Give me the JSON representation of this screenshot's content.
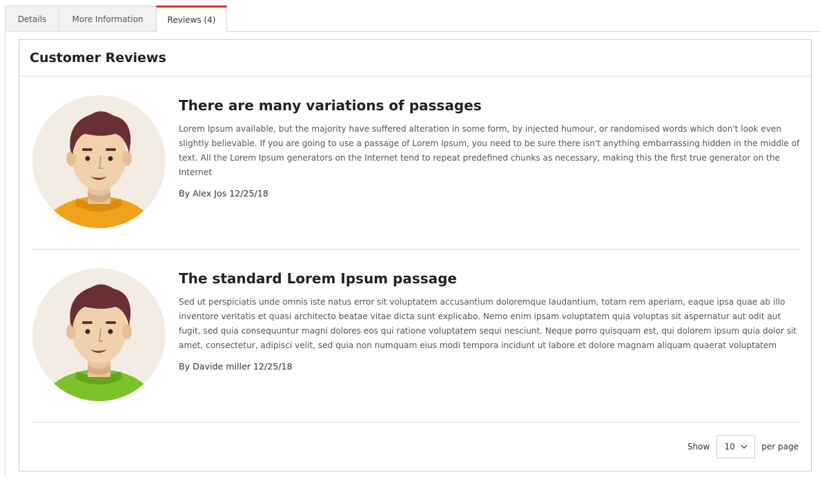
{
  "tabs": [
    {
      "label": "Details",
      "active": false
    },
    {
      "label": "More Information",
      "active": false
    },
    {
      "label": "Reviews (4)",
      "active": true
    }
  ],
  "accent_color": "#e02b27",
  "panel": {
    "title": "Customer Reviews"
  },
  "reviews": [
    {
      "title": "There are many variations of passages",
      "text": "Lorem Ipsum available, but the majority have suffered alteration in some form, by injected humour, or randomised words which don't look even slightly believable. If you are going to use a passage of Lorem Ipsum, you need to be sure there isn't anything embarrassing hidden in the middle of text. All the Lorem Ipsum generators on the Internet tend to repeat predefined chunks as necessary, making this the first true generator on the Internet",
      "byline": "By Alex Jos 12/25/18",
      "avatar": "man-avatar-icon",
      "shirt_color": "#f0a21a"
    },
    {
      "title": "The standard Lorem Ipsum passage",
      "text": "Sed ut perspiciatis unde omnis iste natus error sit voluptatem accusantium doloremque laudantium, totam rem aperiam, eaque ipsa quae ab illo inventore veritatis et quasi architecto beatae vitae dicta sunt explicabo. Nemo enim ipsam voluptatem quia voluptas sit aspernatur aut odit aut fugit, sed quia consequuntur magni dolores eos qui ratione voluptatem sequi nesciunt. Neque porro quisquam est, qui dolorem ipsum quia dolor sit amet, consectetur, adipisci velit, sed quia non numquam eius modi tempora incidunt ut labore et dolore magnam aliquam quaerat voluptatem",
      "byline": "By Davide miller 12/25/18",
      "avatar": "man-avatar-icon",
      "shirt_color": "#7cc22a"
    }
  ],
  "pager": {
    "show_label": "Show",
    "per_page_value": "10",
    "per_page_label": "per page",
    "chevron": "chevron-down-icon"
  }
}
